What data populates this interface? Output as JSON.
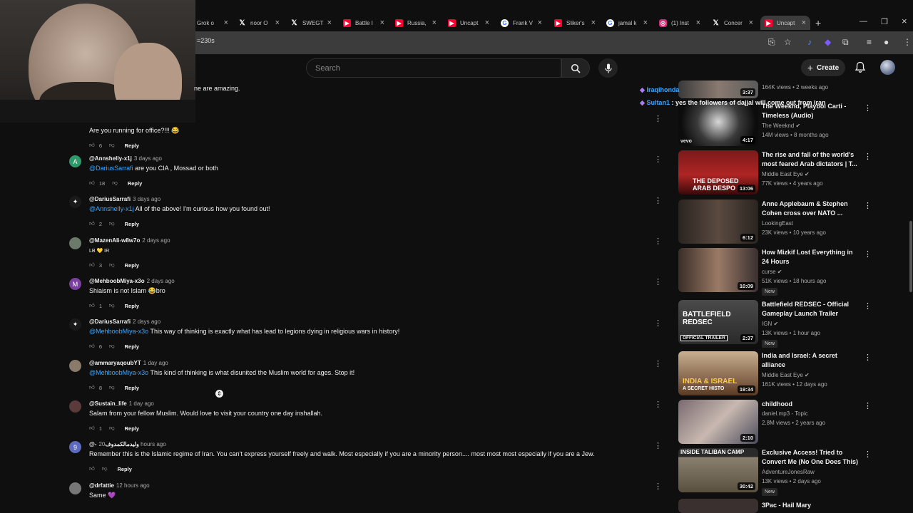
{
  "browser": {
    "tabs": [
      {
        "label": "Grok o",
        "icon": "grok-icon"
      },
      {
        "label": "noor O",
        "icon": "x-icon"
      },
      {
        "label": "SWEGT",
        "icon": "x-icon"
      },
      {
        "label": "Battle I",
        "icon": "youtube-icon"
      },
      {
        "label": "Russia,",
        "icon": "youtube-icon"
      },
      {
        "label": "Uncapt",
        "icon": "youtube-icon"
      },
      {
        "label": "Frank V",
        "icon": "google-icon"
      },
      {
        "label": "Sliker's",
        "icon": "youtube-icon"
      },
      {
        "label": "jamal k",
        "icon": "google-icon"
      },
      {
        "label": "(1) Inst",
        "icon": "instagram-icon"
      },
      {
        "label": "Concer",
        "icon": "x-icon"
      },
      {
        "label": "Uncapt",
        "icon": "youtube-icon"
      }
    ],
    "url": "=230s"
  },
  "header": {
    "search_placeholder": "Search",
    "create_label": "Create"
  },
  "top_partial_text": "ne are amazing.",
  "comments": [
    {
      "handle": "",
      "date": "",
      "avatar": "",
      "avatar_color": "#000000",
      "text": "Are you running for office?!!! 😂",
      "mention": "",
      "likes": "6",
      "reply": "Reply"
    },
    {
      "handle": "@Annshelly-x1j",
      "date": "3 days ago",
      "avatar": "A",
      "avatar_color": "#2e9a6a",
      "mention": "@DariusSarrafi",
      "text": " are you CIA , Mossad or both",
      "likes": "18",
      "reply": "Reply"
    },
    {
      "handle": "@DariusSarrafi",
      "date": "3 days ago",
      "avatar": "✦",
      "avatar_color": "#1a1a1a",
      "mention": "@Annshelly-x1j",
      "text": " All of the above!  I'm curious how you found out!",
      "likes": "2",
      "reply": "Reply"
    },
    {
      "handle": "@MazenAli-w8w7o",
      "date": "2 days ago",
      "avatar": "",
      "avatar_color": "#6b7a6b",
      "mention": "",
      "text": "LB 💛 IR",
      "likes": "3",
      "reply": "Reply"
    },
    {
      "handle": "@MehboobMiya-x3o",
      "date": "2 days ago",
      "avatar": "M",
      "avatar_color": "#7b3fa0",
      "mention": "",
      "text": "Shiaism is not Islam 😂bro",
      "likes": "1",
      "reply": "Reply"
    },
    {
      "handle": "@DariusSarrafi",
      "date": "2 days ago",
      "avatar": "✦",
      "avatar_color": "#1a1a1a",
      "mention": "@MehboobMiya-x3o",
      "text": " This way of thinking is exactly what has lead to legions dying in religious wars in history!",
      "likes": "6",
      "reply": "Reply"
    },
    {
      "handle": "@ammaryaqoubYT",
      "date": "1 day ago",
      "avatar": "",
      "avatar_color": "#8a7a6a",
      "mention": "@MehboobMiya-x3o",
      "text": " This kind of thinking is what disunited the Muslim world for ages. Stop it!",
      "likes": "8",
      "reply": "Reply"
    },
    {
      "handle": "@Sustain_life",
      "date": "1 day ago",
      "avatar": "",
      "avatar_color": "#5a3a3a",
      "mention": "",
      "text": "Salam from your fellow Muslim. Would love to visit your country one day inshallah.",
      "likes": "1",
      "reply": "Reply"
    },
    {
      "handle": "@-وليدمالكمدوف",
      "date": "20 hours ago",
      "avatar": "9",
      "avatar_color": "#5c6bc0",
      "mention": "",
      "text": "Remember this is the Islamic regime of Iran. You can't express yourself freely and walk. Most especially if you are a minority person.... most most most especially if you are a Jew.",
      "likes": "",
      "reply": "Reply"
    },
    {
      "handle": "@drfattie",
      "date": "12 hours ago",
      "avatar": "",
      "avatar_color": "#777777",
      "mention": "",
      "text": "Same 💜",
      "likes": "",
      "reply": ""
    }
  ],
  "live_chat": [
    {
      "user": "Iraqihonda",
      "message": ""
    },
    {
      "user": "Sultan1",
      "message": ": yes the followers of dajjal will come out from iran"
    }
  ],
  "sidebar": [
    {
      "title": "",
      "channel": "",
      "meta": "164K views • 2 weeks ago",
      "duration": "3:37",
      "new": "",
      "verified": false
    },
    {
      "title": "The Weeknd, Playboi Carti - Timeless (Audio)",
      "channel": "The Weeknd",
      "meta": "14M views • 8 months ago",
      "duration": "4:17",
      "new": "",
      "verified": true
    },
    {
      "title": "The rise and fall of the world's most feared Arab dictators | T...",
      "channel": "Middle East Eye",
      "meta": "77K views • 4 years ago",
      "duration": "13:06",
      "new": "",
      "verified": true
    },
    {
      "title": "Anne Applebaum & Stephen Cohen cross over NATO ...",
      "channel": "LookingEast",
      "meta": "23K views • 10 years ago",
      "duration": "6:12",
      "new": "",
      "verified": false
    },
    {
      "title": "How Mizkif Lost Everything in 24 Hours",
      "channel": "curse",
      "meta": "51K views • 18 hours ago",
      "duration": "10:09",
      "new": "New",
      "verified": true
    },
    {
      "title": "Battlefield REDSEC - Official Gameplay Launch Trailer",
      "channel": "IGN",
      "meta": "13K views • 1 hour ago",
      "duration": "2:37",
      "new": "New",
      "verified": true
    },
    {
      "title": "India and Israel: A secret alliance",
      "channel": "Middle East Eye",
      "meta": "161K views • 12 days ago",
      "duration": "19:34",
      "new": "",
      "verified": true
    },
    {
      "title": "childhood",
      "channel": "daniel.mp3 - Topic",
      "meta": "2.8M views • 2 years ago",
      "duration": "2:10",
      "new": "",
      "verified": false
    },
    {
      "title": "Exclusive Access! Tried to Convert Me (No One Does This)",
      "channel": "AdventureJonesRaw",
      "meta": "13K views • 2 days ago",
      "duration": "30:42",
      "new": "New",
      "verified": false
    },
    {
      "title": "3Pac - Hail Mary",
      "channel": "",
      "meta": "",
      "duration": "",
      "new": "",
      "verified": false
    }
  ],
  "thumb_text": {
    "t3a": "THE DEPOSED",
    "t3b": "ARAB DESPO",
    "t6a": "BATTLEFIELD",
    "t6b": "REDSEC",
    "t6c": "OFFICIAL TRAILER",
    "t7a": "INDIA & ISRAEL",
    "t7b": "A SECRET HISTO",
    "t9": "INSIDE TALIBAN CAMP",
    "vevo": "vevo"
  },
  "colors": {
    "accent": "#3ea6ff",
    "youtube_red": "#ff0033",
    "background": "#0f0f0f"
  }
}
